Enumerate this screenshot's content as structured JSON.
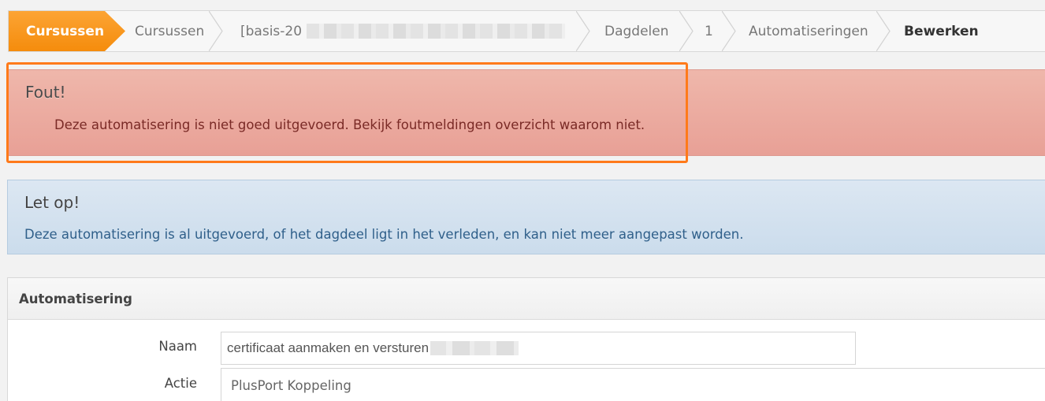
{
  "breadcrumb": {
    "items": [
      {
        "label": "Cursussen"
      },
      {
        "label": "Cursussen"
      },
      {
        "label": "[basis-20"
      },
      {
        "label": "Dagdelen"
      },
      {
        "label": "1"
      },
      {
        "label": "Automatiseringen"
      },
      {
        "label": "Bewerken"
      }
    ],
    "accent_color": "#f7941d"
  },
  "error_alert": {
    "title": "Fout!",
    "message": "Deze automatisering is niet goed uitgevoerd. Bekijk foutmeldingen overzicht waarom niet."
  },
  "info_alert": {
    "title": "Let op!",
    "message": "Deze automatisering is al uitgevoerd, of het dagdeel ligt in het verleden, en kan niet meer aangepast worden."
  },
  "panel": {
    "title": "Automatisering",
    "fields": {
      "naam": {
        "label": "Naam",
        "value": "certificaat aanmaken en versturen"
      },
      "actie": {
        "label": "Actie",
        "value": "PlusPort Koppeling"
      }
    }
  }
}
